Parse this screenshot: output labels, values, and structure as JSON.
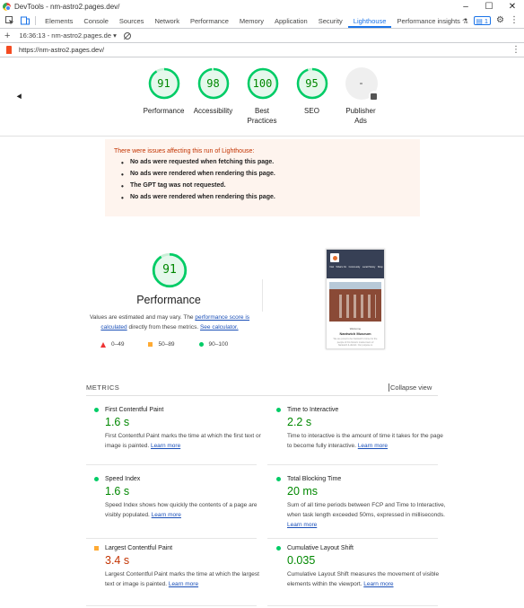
{
  "window": {
    "title": "DevTools - nm-astro2.pages.dev/"
  },
  "tabs": [
    "Elements",
    "Console",
    "Sources",
    "Network",
    "Performance",
    "Memory",
    "Application",
    "Security",
    "Lighthouse",
    "Performance insights"
  ],
  "active_tab": "Lighthouse",
  "issues_count": "1",
  "toolbar": {
    "session": "16:36:13 - nm-astro2.pages.de"
  },
  "url": "https://nm-astro2.pages.dev/",
  "scores": [
    {
      "value": "91",
      "label": "Performance"
    },
    {
      "value": "98",
      "label": "Accessibility"
    },
    {
      "value": "100",
      "label": "Best Practices"
    },
    {
      "value": "95",
      "label": "SEO"
    },
    {
      "value": "-",
      "label": "Publisher Ads"
    }
  ],
  "warnings": {
    "heading": "There were issues affecting this run of Lighthouse:",
    "items": [
      "No ads were requested when fetching this page.",
      "No ads were rendered when rendering this page.",
      "The GPT tag was not requested.",
      "No ads were rendered when rendering this page."
    ]
  },
  "performance": {
    "score": "91",
    "title": "Performance",
    "desc_1": "Values are estimated and may vary. The ",
    "desc_link_1": "performance score is calculated",
    "desc_2": " directly from these metrics. ",
    "desc_link_2": "See calculator.",
    "legend": [
      "0–49",
      "50–89",
      "90–100"
    ]
  },
  "screenshot": {
    "nav": [
      "Visit",
      "What's On",
      "Community",
      "Local History",
      "Shop"
    ],
    "welcome": "Welcome",
    "name": "Nantwich Museum",
    "text": "We are proud to be Nantwich's home for the people of this historic market town of Nantwich & district. Our purpose is"
  },
  "metrics": {
    "title": "METRICS",
    "collapse": "Collapse view",
    "items": [
      {
        "name": "First Contentful Paint",
        "value": "1.6 s",
        "desc": "First Contentful Paint marks the time at which the first text or image is painted. ",
        "link": "Learn more",
        "status": "pass"
      },
      {
        "name": "Time to Interactive",
        "value": "2.2 s",
        "desc": "Time to interactive is the amount of time it takes for the page to become fully interactive. ",
        "link": "Learn more",
        "status": "pass"
      },
      {
        "name": "Speed Index",
        "value": "1.6 s",
        "desc": "Speed Index shows how quickly the contents of a page are visibly populated. ",
        "link": "Learn more",
        "status": "pass"
      },
      {
        "name": "Total Blocking Time",
        "value": "20 ms",
        "desc": "Sum of all time periods between FCP and Time to Interactive, when task length exceeded 50ms, expressed in milliseconds. ",
        "link": "Learn more",
        "status": "pass"
      },
      {
        "name": "Largest Contentful Paint",
        "value": "3.4 s",
        "desc": "Largest Contentful Paint marks the time at which the largest text or image is painted. ",
        "link": "Learn more",
        "status": "average"
      },
      {
        "name": "Cumulative Layout Shift",
        "value": "0.035",
        "desc": "Cumulative Layout Shift measures the movement of visible elements within the viewport. ",
        "link": "Learn more",
        "status": "pass"
      }
    ]
  },
  "colors": {
    "pass": "#0c6",
    "average": "#fa3",
    "fail": "#e33",
    "accent": "#1a73e8"
  }
}
